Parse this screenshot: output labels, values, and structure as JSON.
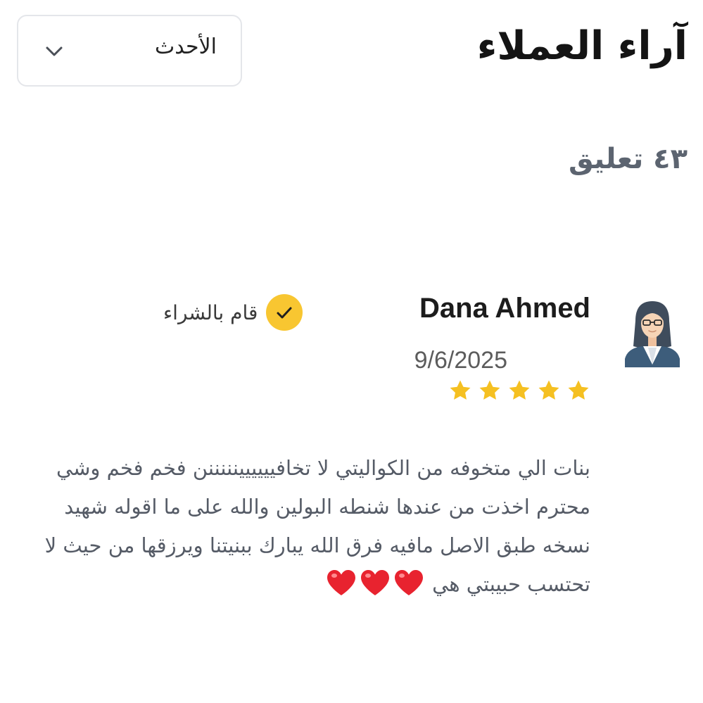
{
  "header": {
    "title": "آراء العملاء"
  },
  "sort": {
    "selected": "الأحدث",
    "icon": "chevron-down-icon"
  },
  "reviews_summary": {
    "count_label": "٤٣ تعليق"
  },
  "review": {
    "name": "Dana Ahmed",
    "date": "9/6/2025",
    "verified_label": "قام بالشراء",
    "rating": 5,
    "max_rating": 5,
    "text": "بنات الي متخوفه من الكواليتي لا تخافيييييينننننن فخم فخم وشي محترم اخذت من عندها شنطه البولين والله على ما اقوله شهيد نسخه طبق الاصل مافيه فرق الله يبارك ببنيتنا ويرزقها من حيث لا تحتسب حبيبتي هي",
    "hearts": 3
  },
  "colors": {
    "star": "#f5c021",
    "badge": "#f8c631",
    "heart": "#e8232f",
    "text_muted": "#555b66"
  }
}
